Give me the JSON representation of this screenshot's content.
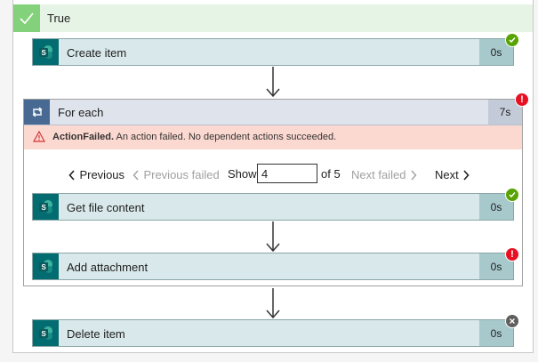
{
  "branch": {
    "label": "True"
  },
  "actions": {
    "create_item": {
      "label": "Create item",
      "duration": "0s",
      "status": "success"
    },
    "delete_item": {
      "label": "Delete item",
      "duration": "0s",
      "status": "skipped"
    }
  },
  "foreach": {
    "label": "For each",
    "duration": "7s",
    "status": "failed",
    "error": {
      "title": "ActionFailed.",
      "message": "An action failed. No dependent actions succeeded."
    },
    "pager": {
      "previous": "Previous",
      "previous_failed": "Previous failed",
      "show": "Show",
      "current_page": "4",
      "of_total": "of 5",
      "next_failed": "Next failed",
      "next": "Next"
    },
    "inner_actions": {
      "get_file_content": {
        "label": "Get file content",
        "duration": "0s",
        "status": "success"
      },
      "add_attachment": {
        "label": "Add attachment",
        "duration": "0s",
        "status": "failed"
      }
    }
  },
  "colors": {
    "sharepoint": "#036c70",
    "success": "#57a300",
    "error": "#e81123",
    "skipped": "#605e5c",
    "true_branch": "#84d17b",
    "error_banner": "#fcd9d0"
  },
  "icons": {
    "branch": "checkmark-icon",
    "connector": "sharepoint-icon",
    "loop": "loop-icon",
    "warning": "warning-icon"
  }
}
